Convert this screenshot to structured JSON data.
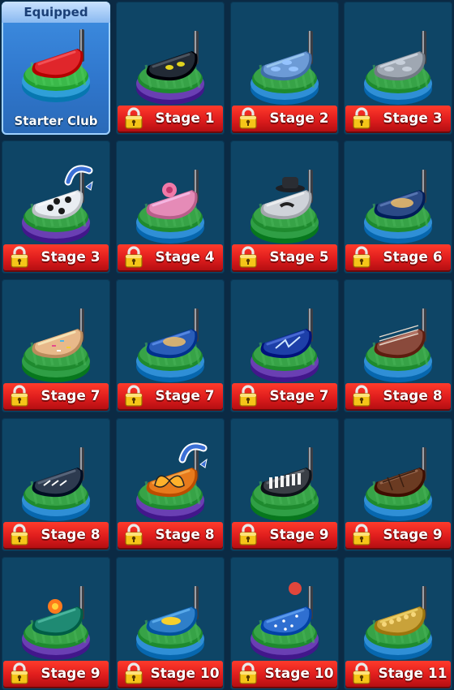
{
  "equipped_label": "Equipped",
  "colors": {
    "background": "#0b2a44",
    "card": "#0e4566",
    "equipped_card": "#3f8fe2",
    "ribbon": "#df1d1d",
    "lock": "#f5c518"
  },
  "clubs": [
    {
      "label": "Starter Club",
      "locked": false,
      "equipped": true,
      "club_color": "#e0262b",
      "pad": "#3bb94a",
      "ring": "#2f9fd8",
      "motif": "plain red",
      "icon": "starter-club-icon"
    },
    {
      "label": "Stage 1",
      "locked": true,
      "club_color": "#222a35",
      "pad": "#37a347",
      "ring": "#6a3fb3",
      "motif": "cat eyes",
      "icon": "cat-eyes-club-icon"
    },
    {
      "label": "Stage 2",
      "locked": true,
      "club_color": "#6d9bd6",
      "pad": "#37a347",
      "ring": "#2f8fd6",
      "motif": "blue camo",
      "icon": "camo-club-icon"
    },
    {
      "label": "Stage 3",
      "locked": true,
      "club_color": "#9fa7b2",
      "pad": "#37a347",
      "ring": "#2f8fd6",
      "motif": "grey camo",
      "icon": "grey-camo-club-icon"
    },
    {
      "label": "Stage 3",
      "locked": true,
      "club_color": "#e9edf2",
      "pad": "#37a347",
      "ring": "#6a3fb3",
      "motif": "soccer ball",
      "icon": "soccer-club-icon",
      "badge": "new-arrow-icon"
    },
    {
      "label": "Stage 4",
      "locked": true,
      "club_color": "#e58bb7",
      "pad": "#37a347",
      "ring": "#2f8fd6",
      "motif": "roses",
      "icon": "rose-club-icon"
    },
    {
      "label": "Stage 5",
      "locked": true,
      "club_color": "#cfd3d9",
      "pad": "#37a347",
      "ring": "#2f9f45",
      "motif": "fedora mustache",
      "icon": "fedora-club-icon"
    },
    {
      "label": "Stage 6",
      "locked": true,
      "club_color": "#2b4a86",
      "pad": "#37a347",
      "ring": "#2f8fd6",
      "motif": "planet",
      "icon": "planet-club-icon"
    },
    {
      "label": "Stage 7",
      "locked": true,
      "club_color": "#e8b98a",
      "pad": "#37a347",
      "ring": "#2f9f45",
      "motif": "donut",
      "icon": "donut-club-icon"
    },
    {
      "label": "Stage 7",
      "locked": true,
      "club_color": "#2a5db8",
      "pad": "#37a347",
      "ring": "#2f8fd6",
      "motif": "galaxy",
      "icon": "galaxy-club-icon"
    },
    {
      "label": "Stage 7",
      "locked": true,
      "club_color": "#1d3fa8",
      "pad": "#37a347",
      "ring": "#6a3fb3",
      "motif": "lightning",
      "icon": "lightning-club-icon"
    },
    {
      "label": "Stage 8",
      "locked": true,
      "club_color": "#8a4a3c",
      "pad": "#37a347",
      "ring": "#2f8fd6",
      "motif": "brick",
      "icon": "brick-club-icon"
    },
    {
      "label": "Stage 8",
      "locked": true,
      "club_color": "#2d3a4f",
      "pad": "#37a347",
      "ring": "#2f8fd6",
      "motif": "sneaker",
      "icon": "sneaker-club-icon"
    },
    {
      "label": "Stage 8",
      "locked": true,
      "club_color": "#e77a1c",
      "pad": "#37a347",
      "ring": "#6a3fb3",
      "motif": "butterfly",
      "icon": "butterfly-club-icon",
      "badge": "new-arrow-icon"
    },
    {
      "label": "Stage 9",
      "locked": true,
      "club_color": "#3a3f46",
      "pad": "#37a347",
      "ring": "#2f9f45",
      "motif": "piano keys",
      "icon": "piano-club-icon"
    },
    {
      "label": "Stage 9",
      "locked": true,
      "club_color": "#6b3b22",
      "pad": "#37a347",
      "ring": "#2f8fd6",
      "motif": "chocolate",
      "icon": "chocolate-club-icon"
    },
    {
      "label": "Stage 9",
      "locked": true,
      "club_color": "#1f8a73",
      "pad": "#37a347",
      "ring": "#6a3fb3",
      "motif": "hibiscus",
      "icon": "hibiscus-club-icon"
    },
    {
      "label": "Stage 10",
      "locked": true,
      "club_color": "#2f7fc9",
      "pad": "#37a347",
      "ring": "#2f8fd6",
      "motif": "tropical fish",
      "icon": "fish-club-icon"
    },
    {
      "label": "Stage 10",
      "locked": true,
      "club_color": "#2f6fd1",
      "pad": "#37a347",
      "ring": "#6a3fb3",
      "motif": "stars balloon",
      "icon": "stars-club-icon"
    },
    {
      "label": "Stage 11",
      "locked": true,
      "club_color": "#c9a23a",
      "pad": "#37a347",
      "ring": "#2f8fd6",
      "motif": "corn",
      "icon": "corn-club-icon"
    }
  ]
}
